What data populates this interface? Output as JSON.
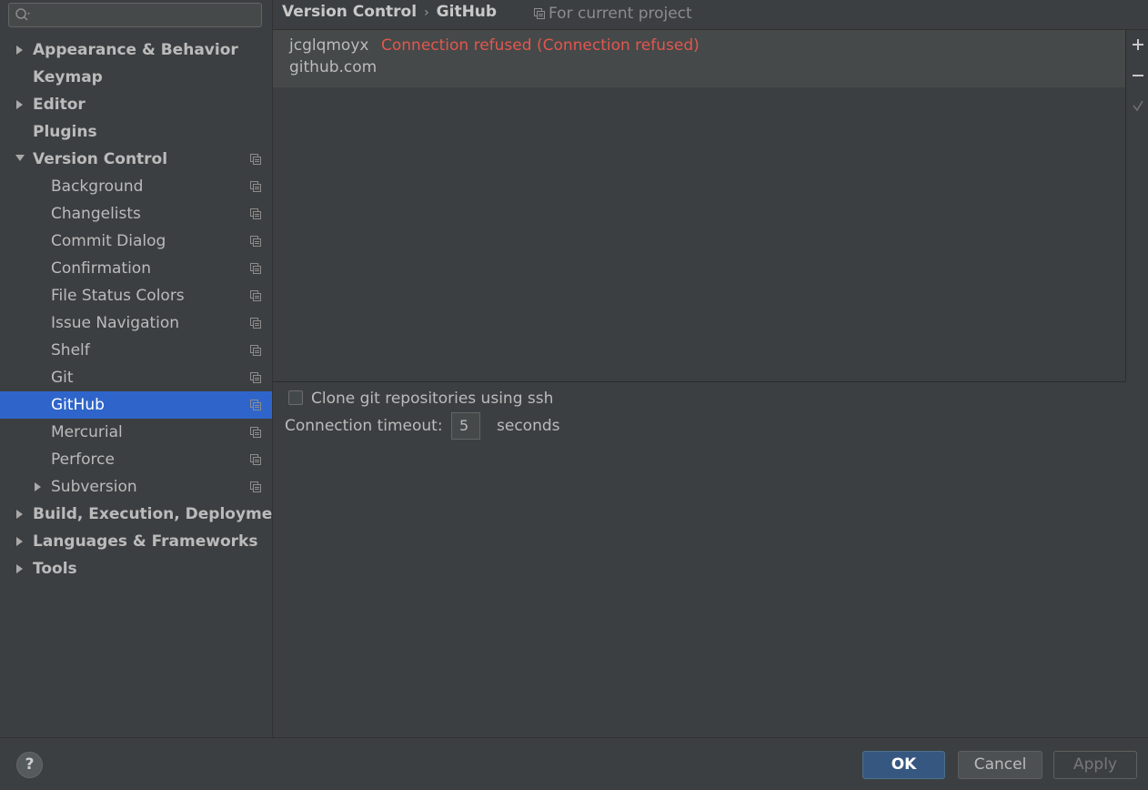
{
  "search": {
    "placeholder": ""
  },
  "sidebar": {
    "items": [
      {
        "label": "Appearance & Behavior",
        "level": 0,
        "arrow": "right",
        "project": false
      },
      {
        "label": "Keymap",
        "level": 0,
        "arrow": "none",
        "project": false
      },
      {
        "label": "Editor",
        "level": 0,
        "arrow": "right",
        "project": false
      },
      {
        "label": "Plugins",
        "level": 0,
        "arrow": "none",
        "project": false
      },
      {
        "label": "Version Control",
        "level": 0,
        "arrow": "down",
        "project": true
      },
      {
        "label": "Background",
        "level": 1,
        "arrow": "none",
        "project": true
      },
      {
        "label": "Changelists",
        "level": 1,
        "arrow": "none",
        "project": true
      },
      {
        "label": "Commit Dialog",
        "level": 1,
        "arrow": "none",
        "project": true
      },
      {
        "label": "Confirmation",
        "level": 1,
        "arrow": "none",
        "project": true
      },
      {
        "label": "File Status Colors",
        "level": 1,
        "arrow": "none",
        "project": true
      },
      {
        "label": "Issue Navigation",
        "level": 1,
        "arrow": "none",
        "project": true
      },
      {
        "label": "Shelf",
        "level": 1,
        "arrow": "none",
        "project": true
      },
      {
        "label": "Git",
        "level": 1,
        "arrow": "none",
        "project": true
      },
      {
        "label": "GitHub",
        "level": 1,
        "arrow": "none",
        "project": true,
        "selected": true
      },
      {
        "label": "Mercurial",
        "level": 1,
        "arrow": "none",
        "project": true
      },
      {
        "label": "Perforce",
        "level": 1,
        "arrow": "none",
        "project": true
      },
      {
        "label": "Subversion",
        "level": 1,
        "arrow": "right",
        "project": true
      },
      {
        "label": "Build, Execution, Deployment",
        "level": 0,
        "arrow": "right",
        "project": false
      },
      {
        "label": "Languages & Frameworks",
        "level": 0,
        "arrow": "right",
        "project": false
      },
      {
        "label": "Tools",
        "level": 0,
        "arrow": "right",
        "project": false
      }
    ]
  },
  "header": {
    "breadcrumb_parent": "Version Control",
    "breadcrumb_current": "GitHub",
    "scope_label": "For current project"
  },
  "accounts": [
    {
      "user": "jcglqmoyx",
      "error": "Connection refused (Connection refused)",
      "host": "github.com"
    }
  ],
  "toolbar": {
    "icons": [
      "plus-icon",
      "minus-icon",
      "check-icon"
    ]
  },
  "options": {
    "clone_ssh_label": "Clone git repositories using ssh",
    "clone_ssh_checked": false,
    "timeout_label": "Connection timeout:",
    "timeout_value": "5",
    "timeout_unit": "seconds"
  },
  "footer": {
    "help_label": "?",
    "ok_label": "OK",
    "cancel_label": "Cancel",
    "apply_label": "Apply"
  },
  "colors": {
    "background": "#3c3f41",
    "selection": "#2f65ca",
    "error": "#e3574d",
    "ok_button": "#365880"
  }
}
